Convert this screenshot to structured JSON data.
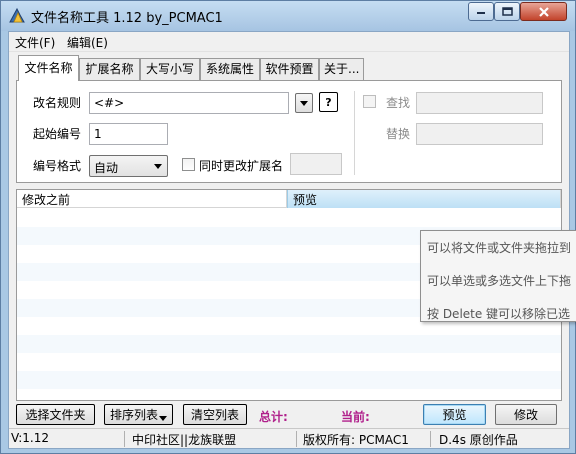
{
  "window": {
    "title": "文件名称工具 1.12  by_PCMAC1"
  },
  "menu": {
    "file": "文件(F)",
    "edit": "编辑(E)"
  },
  "tabs": [
    {
      "label": "文件名称",
      "active": true
    },
    {
      "label": "扩展名称",
      "active": false
    },
    {
      "label": "大写小写",
      "active": false
    },
    {
      "label": "系统属性",
      "active": false
    },
    {
      "label": "软件预置",
      "active": false
    },
    {
      "label": "关于...",
      "active": false
    }
  ],
  "form": {
    "rename_rule_label": "改名规则",
    "rename_rule_value": "<#>",
    "help_button": "?",
    "start_number_label": "起始编号",
    "start_number_value": "1",
    "number_format_label": "编号格式",
    "number_format_value": "自动",
    "also_change_ext_label": "同时更改扩展名",
    "find_label": "查找",
    "replace_label": "替换"
  },
  "list": {
    "columns": [
      "修改之前",
      "预览"
    ]
  },
  "tooltip": {
    "lines": [
      "可以将文件或文件夹拖拉到",
      "可以单选或多选文件上下拖",
      "按 Delete 键可以移除已选"
    ]
  },
  "buttons": {
    "select_files": "选择文件夹",
    "sort_list": "排序列表",
    "clear_list": "清空列表",
    "total_label": "总计:",
    "current_label": "当前:",
    "preview": "预览",
    "modify": "修改"
  },
  "statusbar": {
    "version": "V:1.12",
    "community": "中印社区||龙族联盟",
    "copyright": "版权所有: PCMAC1",
    "original": "D.4s 原创作品"
  },
  "colors": {
    "accent_label": "#b0208b",
    "titlebar": "#a9c8e4"
  }
}
